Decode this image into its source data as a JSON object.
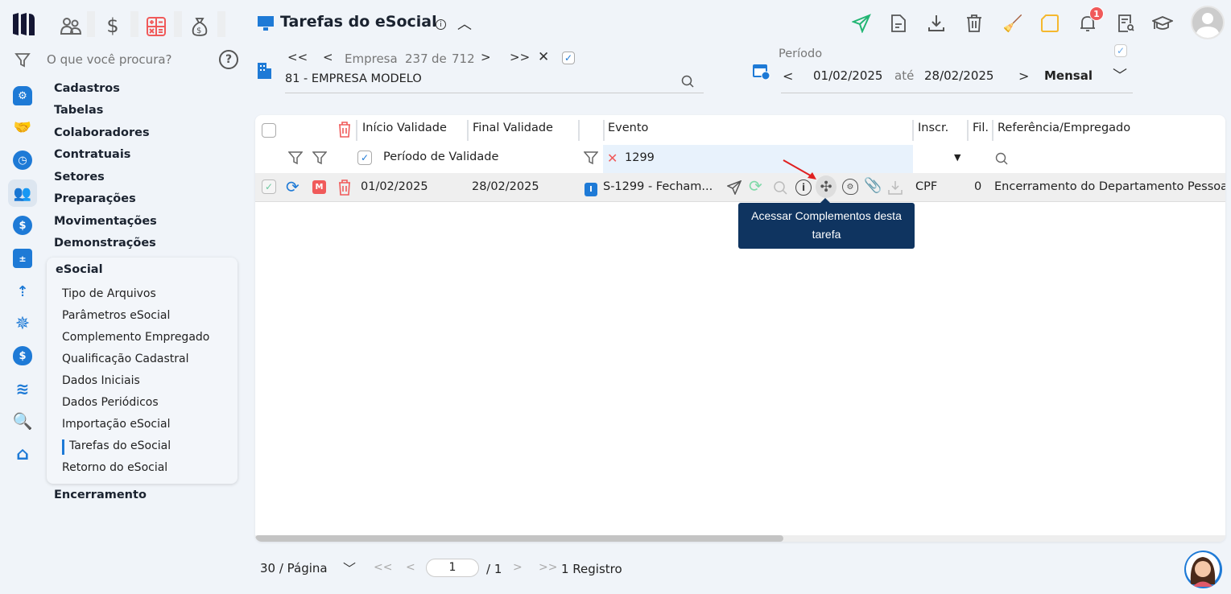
{
  "app": {
    "logo": "M",
    "search_placeholder": "O que você procura?"
  },
  "topnav": [
    {
      "icon": "people-icon"
    },
    {
      "icon": "dollar-icon"
    },
    {
      "icon": "calculator-icon"
    },
    {
      "icon": "money-bag-icon"
    }
  ],
  "sidebar": {
    "menu": [
      "Cadastros",
      "Tabelas",
      "Colaboradores",
      "Contratuais",
      "Setores",
      "Preparações",
      "Movimentações",
      "Demonstrações"
    ],
    "esocial": {
      "title": "eSocial",
      "items": [
        "Tipo de Arquivos",
        "Parâmetros eSocial",
        "Complemento Empregado",
        "Qualificação Cadastral",
        "Dados Iniciais",
        "Dados Periódicos",
        "Importação eSocial",
        "Tarefas do eSocial",
        "Retorno do eSocial"
      ],
      "active": "Tarefas do eSocial"
    },
    "after": "Encerramento"
  },
  "header": {
    "title": "Tarefas do eSocial",
    "notifications": "1"
  },
  "empresa": {
    "label": "Empresa",
    "current": "237",
    "de": "de",
    "total": "712",
    "value": "81 - EMPRESA MODELO"
  },
  "periodo": {
    "label": "Período",
    "start": "01/02/2025",
    "ate": "até",
    "end": "28/02/2025",
    "mode": "Mensal"
  },
  "table": {
    "headers": {
      "inicio": "Início Validade",
      "final": "Final Validade",
      "evento": "Evento",
      "inscr": "Inscr.",
      "fil": "Fil.",
      "ref": "Referência/Empregado"
    },
    "filters": {
      "periodo": "Período de Validade",
      "evento": "1299"
    },
    "rows": [
      {
        "badge": "M",
        "inicio": "01/02/2025",
        "final": "28/02/2025",
        "tipo": "I",
        "evento": "S-1299 - Fecham...",
        "inscr": "CPF",
        "fil": "0",
        "ref": "Encerramento do Departamento Pessoal"
      }
    ]
  },
  "tooltip": "Acessar Complementos desta tarefa",
  "pagination": {
    "per_page": "30 / Página",
    "page": "1",
    "total_pages": "/ 1",
    "records": "1 Registro"
  },
  "colors": {
    "accent": "#1e7ad6",
    "tooltip": "#0f3460",
    "danger": "#f05a5a"
  }
}
